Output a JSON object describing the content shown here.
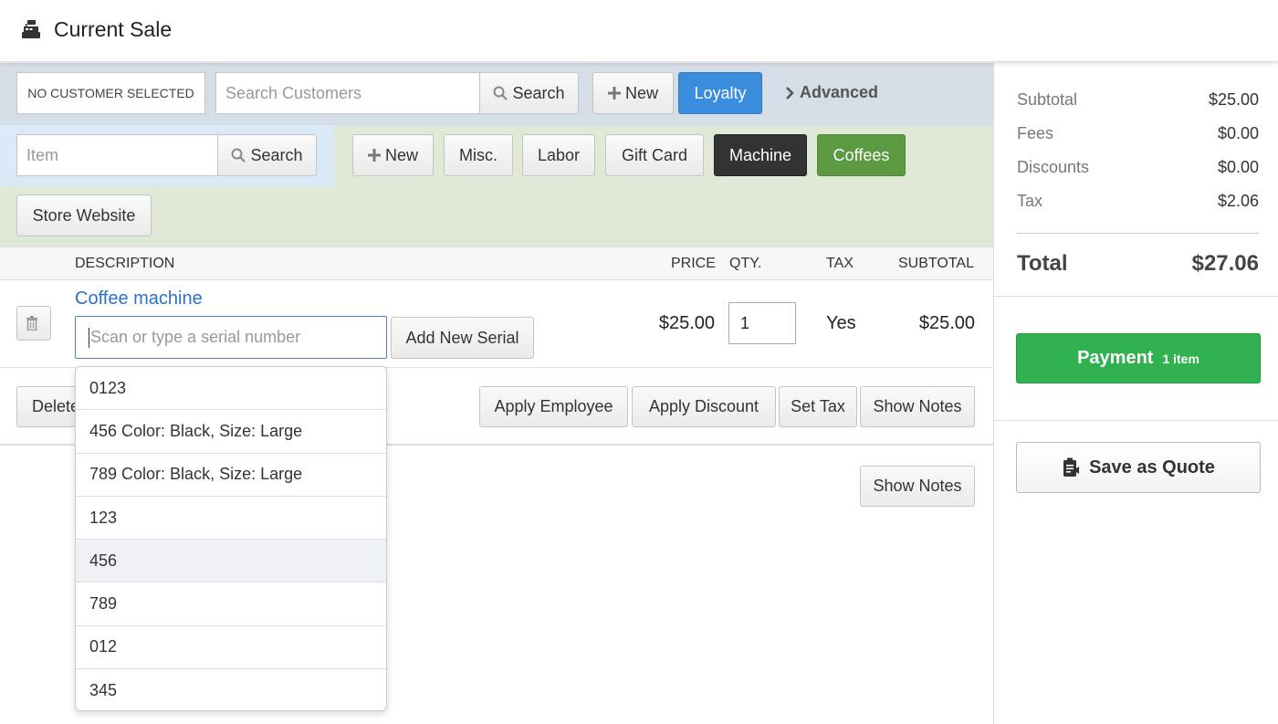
{
  "header": {
    "title": "Current Sale",
    "icon": "cash-register-icon"
  },
  "customer": {
    "no_customer": "NO CUSTOMER SELECTED",
    "search_placeholder": "Search Customers",
    "search_label": "Search",
    "new_label": "New",
    "loyalty_label": "Loyalty",
    "advanced_label": "Advanced"
  },
  "items": {
    "item_placeholder": "Item",
    "search_label": "Search",
    "buttons": {
      "new": "New",
      "misc": "Misc.",
      "labor": "Labor",
      "gift_card": "Gift Card",
      "machine": "Machine",
      "coffees": "Coffees",
      "store_website": "Store Website"
    }
  },
  "table": {
    "columns": {
      "description": "DESCRIPTION",
      "price": "PRICE",
      "qty": "QTY.",
      "tax": "TAX",
      "subtotal": "SUBTOTAL"
    }
  },
  "line_item": {
    "name": "Coffee machine",
    "serial_placeholder": "Scan or type a serial number",
    "add_serial_label": "Add New Serial",
    "price": "$25.00",
    "qty": "1",
    "tax": "Yes",
    "subtotal": "$25.00",
    "delete_label": "Delete",
    "apply_employee": "Apply Employee",
    "apply_discount": "Apply Discount",
    "set_tax": "Set Tax",
    "show_notes": "Show Notes"
  },
  "sale_notes": {
    "show_notes": "Show Notes"
  },
  "serial_options": [
    "0123",
    "456 Color: Black, Size: Large",
    "789 Color: Black, Size: Large",
    "123",
    "456",
    "789",
    "012",
    "345"
  ],
  "summary": {
    "subtotal_label": "Subtotal",
    "subtotal": "$25.00",
    "fees_label": "Fees",
    "fees": "$0.00",
    "discounts_label": "Discounts",
    "discounts": "$0.00",
    "tax_label": "Tax",
    "tax": "$2.06",
    "total_label": "Total",
    "total": "$27.06"
  },
  "payment": {
    "label": "Payment",
    "count": "1 item"
  },
  "quote": {
    "label": "Save as Quote"
  },
  "colors": {
    "loyalty": "#3a8ddc",
    "machine": "#333333",
    "coffees": "#5c9a41",
    "payment": "#2fb24f",
    "link": "#2a72c4"
  }
}
